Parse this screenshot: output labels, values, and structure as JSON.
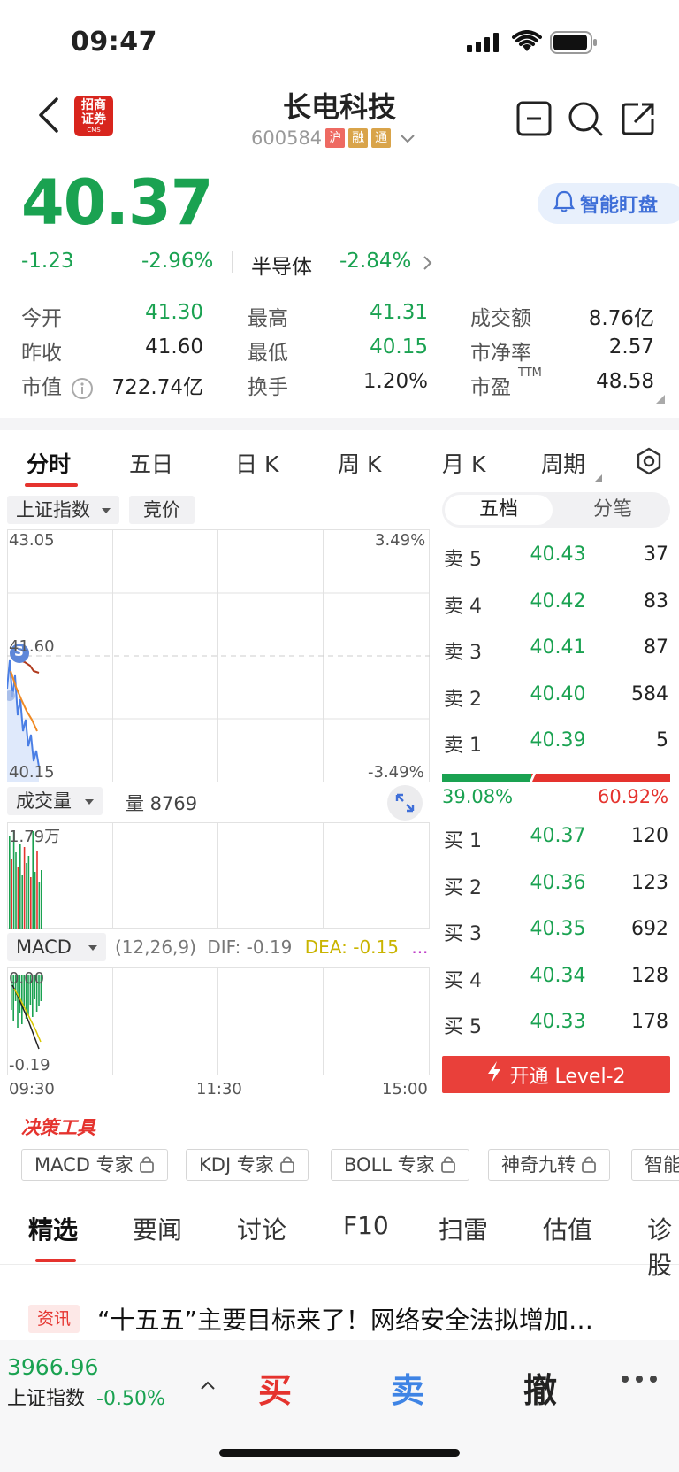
{
  "status": {
    "time": "09:47"
  },
  "header": {
    "logo_text_1": "招商",
    "logo_text_2": "证券",
    "logo_sub": "CMS",
    "title": "长电科技",
    "code": "600584",
    "tags": [
      "沪",
      "融",
      "通"
    ]
  },
  "quote": {
    "price": "40.37",
    "change": "-1.23",
    "change_pct": "-2.96%",
    "sector_name": "半导体",
    "sector_pct": "-2.84%",
    "smart_button": "智能盯盘"
  },
  "stats": [
    {
      "label": "今开",
      "value": "41.30",
      "color": "green"
    },
    {
      "label": "最高",
      "value": "41.31",
      "color": "green"
    },
    {
      "label": "成交额",
      "value": "8.76亿",
      "color": "dark"
    },
    {
      "label": "昨收",
      "value": "41.60",
      "color": "dark"
    },
    {
      "label": "最低",
      "value": "40.15",
      "color": "green"
    },
    {
      "label": "市净率",
      "value": "2.57",
      "color": "dark"
    },
    {
      "label": "市值",
      "value": "722.74亿",
      "color": "dark"
    },
    {
      "label": "换手",
      "value": "1.20%",
      "color": "dark"
    },
    {
      "label": "市盈",
      "value": "48.58",
      "color": "dark",
      "sup": "TTM"
    }
  ],
  "chart_tabs": [
    "分时",
    "五日",
    "日 K",
    "周 K",
    "月 K",
    "周期"
  ],
  "chart_controls": {
    "index_select": "上证指数",
    "auction": "竞价",
    "volume_select": "成交量",
    "volume_label": "量 8769",
    "macd_select": "MACD",
    "macd_params": "(12,26,9)",
    "dif": "DIF: -0.19",
    "dea": "DEA: -0.15",
    "more": "..."
  },
  "chart_labels": {
    "price_max": "43.05",
    "pct_max": "3.49%",
    "prev_close": "41.60",
    "price_min": "40.15",
    "pct_min": "-3.49%",
    "vol_max": "1.79万",
    "macd_max": "0.00",
    "macd_min": "-0.19",
    "time_start": "09:30",
    "time_mid": "11:30",
    "time_end": "15:00",
    "s_marker": "S"
  },
  "orderbook": {
    "toggle_on": "五档",
    "toggle_off": "分笔",
    "asks": [
      {
        "label": "卖 5",
        "price": "40.43",
        "vol": "37"
      },
      {
        "label": "卖 4",
        "price": "40.42",
        "vol": "83"
      },
      {
        "label": "卖 3",
        "price": "40.41",
        "vol": "87"
      },
      {
        "label": "卖 2",
        "price": "40.40",
        "vol": "584"
      },
      {
        "label": "卖 1",
        "price": "40.39",
        "vol": "5"
      }
    ],
    "buy_pct": "39.08%",
    "sell_pct": "60.92%",
    "buy_ratio": 0.3908,
    "bids": [
      {
        "label": "买 1",
        "price": "40.37",
        "vol": "120"
      },
      {
        "label": "买 2",
        "price": "40.36",
        "vol": "123"
      },
      {
        "label": "买 3",
        "price": "40.35",
        "vol": "692"
      },
      {
        "label": "买 4",
        "price": "40.34",
        "vol": "128"
      },
      {
        "label": "买 5",
        "price": "40.33",
        "vol": "178"
      }
    ],
    "level2": "开通 Level-2"
  },
  "tools": {
    "title": "决策工具",
    "items": [
      "MACD 专家",
      "KDJ 专家",
      "BOLL 专家",
      "神奇九转",
      "智能"
    ]
  },
  "news_tabs": [
    "精选",
    "要闻",
    "讨论",
    "F10",
    "扫雷",
    "估值",
    "诊股"
  ],
  "news": {
    "tag": "资讯",
    "title": "“十五五”主要目标来了！网络安全法拟增加…"
  },
  "bottom": {
    "index_value": "3966.96",
    "index_name": "上证指数",
    "index_pct": "-0.50%",
    "buy": "买",
    "sell": "卖",
    "cancel": "撤"
  },
  "colors": {
    "up": "#e5332e",
    "down": "#1aa251",
    "accent": "#3f6fd8"
  }
}
